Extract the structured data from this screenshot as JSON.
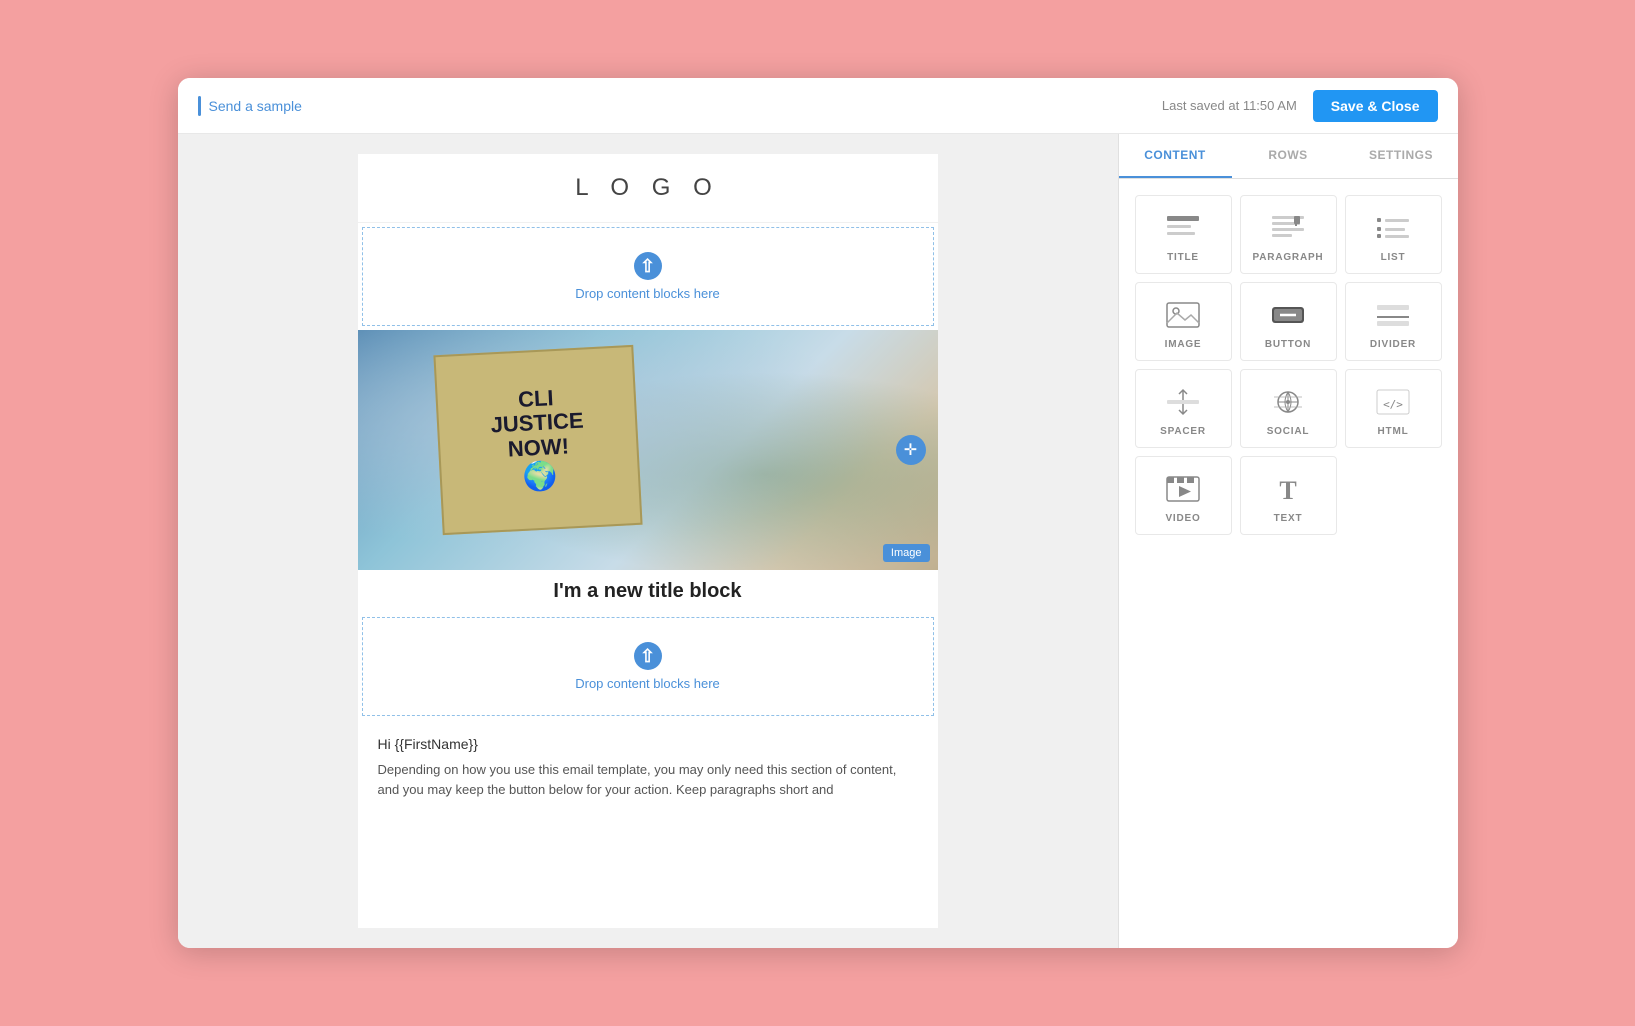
{
  "topBar": {
    "sendSample": "Send a sample",
    "lastSaved": "Last saved at 11:50 AM",
    "saveCloseBtn": "Save & Close"
  },
  "emailPreview": {
    "logoText": "L O G O",
    "dropZone1": "Drop content blocks here",
    "dropZone2": "Drop content blocks here",
    "imageBadge": "Image",
    "titleBlock": "I'm a new title block",
    "greeting": "Hi {{FirstName}}",
    "bodyText": "Depending on how you use this email template, you may only need this section of content, and you may keep the button below for your action. Keep paragraphs short and"
  },
  "rightPanel": {
    "tabs": [
      {
        "id": "content",
        "label": "CONTENT"
      },
      {
        "id": "rows",
        "label": "ROWS"
      },
      {
        "id": "settings",
        "label": "SETTINGS"
      }
    ],
    "activeTab": "content",
    "blocks": [
      {
        "id": "title",
        "label": "TITLE"
      },
      {
        "id": "paragraph",
        "label": "PARAGRAPH"
      },
      {
        "id": "list",
        "label": "LIST"
      },
      {
        "id": "image",
        "label": "IMAGE"
      },
      {
        "id": "button",
        "label": "BUTTON"
      },
      {
        "id": "divider",
        "label": "DIVIDER"
      },
      {
        "id": "spacer",
        "label": "SPACER"
      },
      {
        "id": "social",
        "label": "SOCIAL"
      },
      {
        "id": "html",
        "label": "HTML"
      },
      {
        "id": "video",
        "label": "VIDEO"
      },
      {
        "id": "text",
        "label": "TEXT"
      }
    ]
  }
}
